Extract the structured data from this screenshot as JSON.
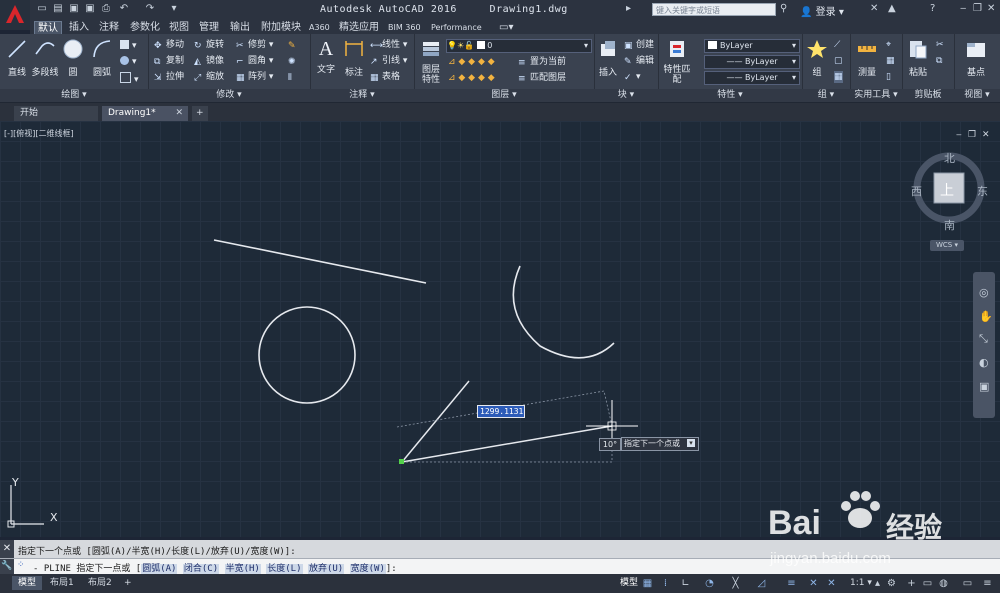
{
  "title_bar": {
    "app_title": "Autodesk AutoCAD 2016",
    "doc_title": "Drawing1.dwg",
    "search_placeholder": "键入关键字或短语",
    "login_label": "登录"
  },
  "ribbon_tabs": [
    "默认",
    "插入",
    "注释",
    "参数化",
    "视图",
    "管理",
    "输出",
    "附加模块",
    "A360",
    "精选应用",
    "BIM 360",
    "Performance"
  ],
  "panels": {
    "draw": {
      "title": "绘图",
      "line": "直线",
      "polyline": "多段线",
      "circle": "圆",
      "arc": "圆弧"
    },
    "modify": {
      "title": "修改",
      "move": "移动",
      "rotate": "旋转",
      "trim": "修剪",
      "copy": "复制",
      "mirror": "镜像",
      "fillet": "圆角",
      "stretch": "拉伸",
      "scale": "缩放",
      "array": "阵列"
    },
    "annotation": {
      "title": "注释",
      "text": "文字",
      "dimension": "标注",
      "linear": "线性",
      "leader": "引线",
      "table": "表格"
    },
    "layers": {
      "title": "图层",
      "layer_props": "图层特性",
      "layer_value": "0",
      "set_current": "置为当前",
      "match_layer": "匹配图层"
    },
    "block": {
      "title": "块",
      "insert": "插入",
      "create": "创建",
      "edit": "编辑"
    },
    "properties": {
      "title": "特性",
      "match": "特性匹配",
      "color": "ByLayer",
      "linetype": "ByLayer",
      "lineweight": "ByLayer"
    },
    "groups": {
      "title": "组",
      "group": "组"
    },
    "utilities": {
      "title": "实用工具",
      "measure": "测量"
    },
    "clipboard": {
      "title": "剪贴板",
      "paste": "粘贴"
    },
    "view": {
      "title": "视图",
      "base": "基点"
    }
  },
  "doc_tabs": [
    "开始",
    "Drawing1*"
  ],
  "viewport_label": "[-][俯视][二维线框]",
  "viewcube": {
    "north": "北",
    "south": "南",
    "east": "东",
    "west": "西",
    "top": "上",
    "wcs": "WCS"
  },
  "drawing": {
    "dynamic_input_value": "1299.1131",
    "angle_value": "10°",
    "tooltip": "指定下一个点或",
    "ucs_x": "X",
    "ucs_y": "Y"
  },
  "command": {
    "history": "指定下一个点或 [圆弧(A)/半宽(H)/长度(L)/放弃(U)/宽度(W)]:",
    "prompt_prefix": "- PLINE 指定下一点或 [",
    "options": [
      "圆弧(A)",
      "闭合(C)",
      "半宽(H)",
      "长度(L)",
      "放弃(U)",
      "宽度(W)"
    ],
    "suffix": "]:"
  },
  "status": {
    "tabs": [
      "模型",
      "布局1",
      "布局2"
    ],
    "model_label": "模型",
    "scale": "1:1"
  },
  "watermark": {
    "brand": "Bai",
    "brand2": "经验",
    "url": "jingyan.baidu.com"
  }
}
